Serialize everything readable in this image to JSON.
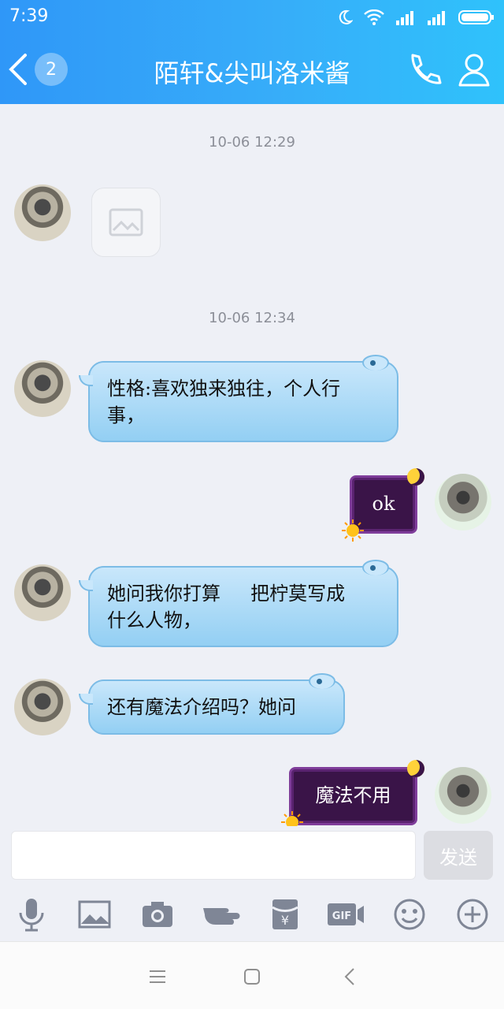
{
  "status": {
    "time": "7:39"
  },
  "header": {
    "back_count": "2",
    "title": "陌轩&尖叫洛米酱"
  },
  "messages": {
    "ts1": "10-06 12:29",
    "ts2": "10-06 12:34",
    "m1_line1": "性格:喜欢独来独往，个人行",
    "m1_line2": "事，",
    "m2": "ok",
    "m3_line1": "她问我你打算     把柠莫写成",
    "m3_line2": "什么人物，",
    "m4": "还有魔法介绍吗？她问",
    "m5": "魔法不用"
  },
  "input": {
    "placeholder": "",
    "send_label": "发送"
  },
  "toolbar": {
    "items": [
      "mic-icon",
      "image-icon",
      "camera-icon",
      "poke-icon",
      "red-packet-icon",
      "gif-icon",
      "emoji-icon",
      "plus-icon"
    ]
  },
  "colors": {
    "header_start": "#2f97f8",
    "header_end": "#2fc2fb",
    "bubble": "#a9daf6",
    "dark_bubble": "#3a1448"
  }
}
